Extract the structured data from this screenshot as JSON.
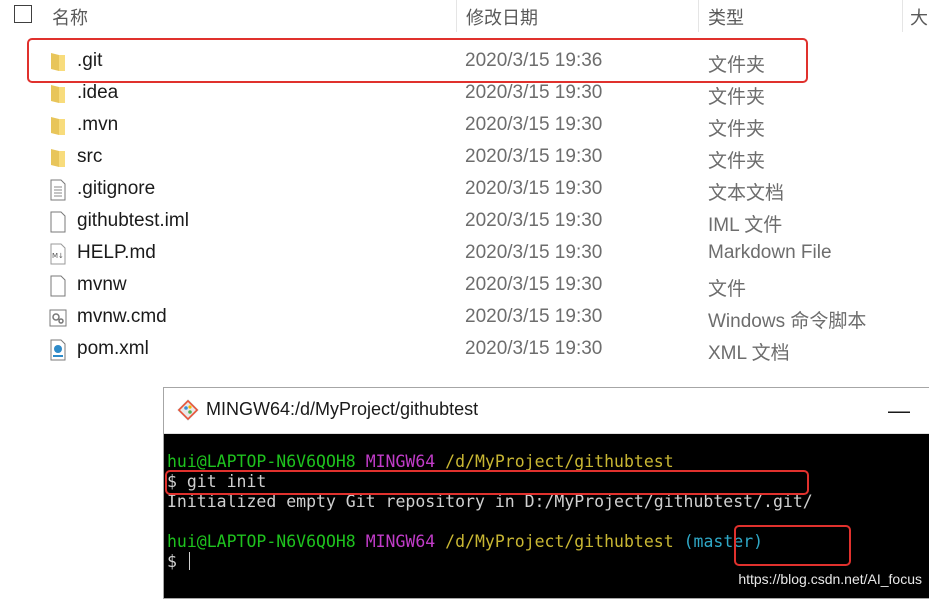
{
  "explorer": {
    "columns": {
      "name": "名称",
      "date": "修改日期",
      "type": "类型",
      "size": "大"
    },
    "rows": [
      {
        "name": ".git",
        "date": "2020/3/15 19:36",
        "type": "文件夹",
        "icon": "folder-icon"
      },
      {
        "name": ".idea",
        "date": "2020/3/15 19:30",
        "type": "文件夹",
        "icon": "folder-icon"
      },
      {
        "name": ".mvn",
        "date": "2020/3/15 19:30",
        "type": "文件夹",
        "icon": "folder-icon"
      },
      {
        "name": "src",
        "date": "2020/3/15 19:30",
        "type": "文件夹",
        "icon": "folder-icon"
      },
      {
        "name": ".gitignore",
        "date": "2020/3/15 19:30",
        "type": "文本文档",
        "icon": "text-document-icon"
      },
      {
        "name": "githubtest.iml",
        "date": "2020/3/15 19:30",
        "type": "IML 文件",
        "icon": "file-icon"
      },
      {
        "name": "HELP.md",
        "date": "2020/3/15 19:30",
        "type": "Markdown File",
        "icon": "markdown-file-icon"
      },
      {
        "name": "mvnw",
        "date": "2020/3/15 19:30",
        "type": "文件",
        "icon": "file-icon"
      },
      {
        "name": "mvnw.cmd",
        "date": "2020/3/15 19:30",
        "type": "Windows 命令脚本",
        "icon": "cmd-script-icon"
      },
      {
        "name": "pom.xml",
        "date": "2020/3/15 19:30",
        "type": "XML 文档",
        "icon": "xml-document-icon"
      }
    ]
  },
  "terminal": {
    "title": "MINGW64:/d/MyProject/githubtest",
    "prompt1": {
      "user": "hui@LAPTOP-N6V6QOH8",
      "env": "MINGW64",
      "path": "/d/MyProject/githubtest"
    },
    "command": "$ git init",
    "output": "Initialized empty Git repository in D:/MyProject/githubtest/.git/",
    "prompt2": {
      "user": "hui@LAPTOP-N6V6QOH8",
      "env": "MINGW64",
      "path": "/d/MyProject/githubtest",
      "branch": "(master)"
    },
    "input_prompt": "$ ",
    "colors": {
      "user": "#1ec21e",
      "env": "#c13cc8",
      "path": "#c9b733",
      "branch": "#2fa8c7",
      "highlight": "#e0312d"
    }
  },
  "watermark": "https://blog.csdn.net/AI_focus"
}
